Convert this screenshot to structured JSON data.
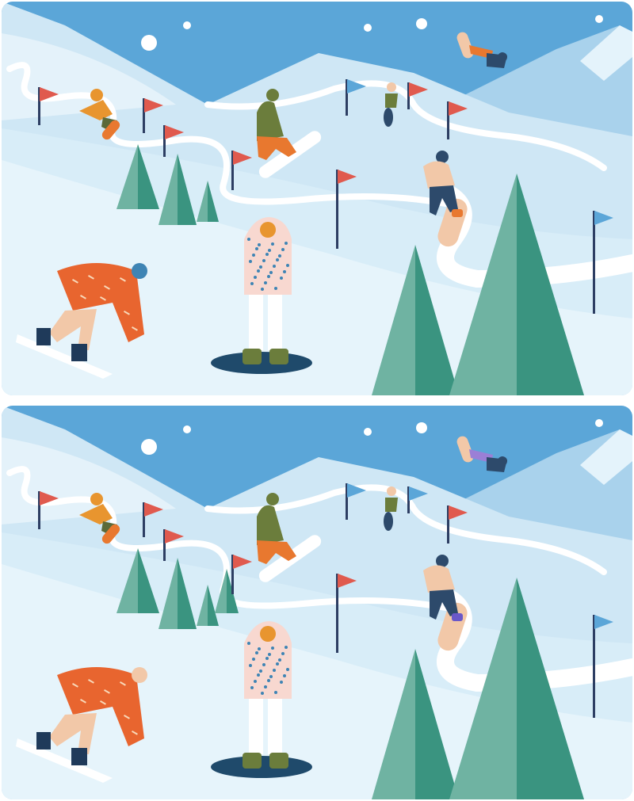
{
  "game": {
    "panels": [
      {
        "id": "top",
        "palette": {
          "sky": "#5ba6d8",
          "rider_top_left_pants": "#e8782f",
          "rider_center_right_pants": "#2d4a6b",
          "rider_center_right_shoe": "#e8782f",
          "tree_center_visible": false,
          "cap_bottom_left": "#3e84b4",
          "flag_far_left_color": "#e05a4e",
          "flag_mid_right_color": "#e05a4e",
          "flag_center_color": "#e05a4e",
          "jacket_dots": "#3e84b4"
        }
      },
      {
        "id": "bottom",
        "palette": {
          "sky": "#5ba6d8",
          "rider_top_left_pants": "#9b7fd6",
          "rider_center_right_pants": "#2d4a6b",
          "rider_center_right_shoe": "#6a58c8",
          "tree_center_visible": true,
          "cap_bottom_left": "#f2c8a8",
          "flag_far_left_color": "#e05a4e",
          "flag_mid_right_color": "#e05a4e",
          "flag_center_color": "#5ba6d8",
          "jacket_dots": "#3e84b4"
        }
      }
    ]
  }
}
